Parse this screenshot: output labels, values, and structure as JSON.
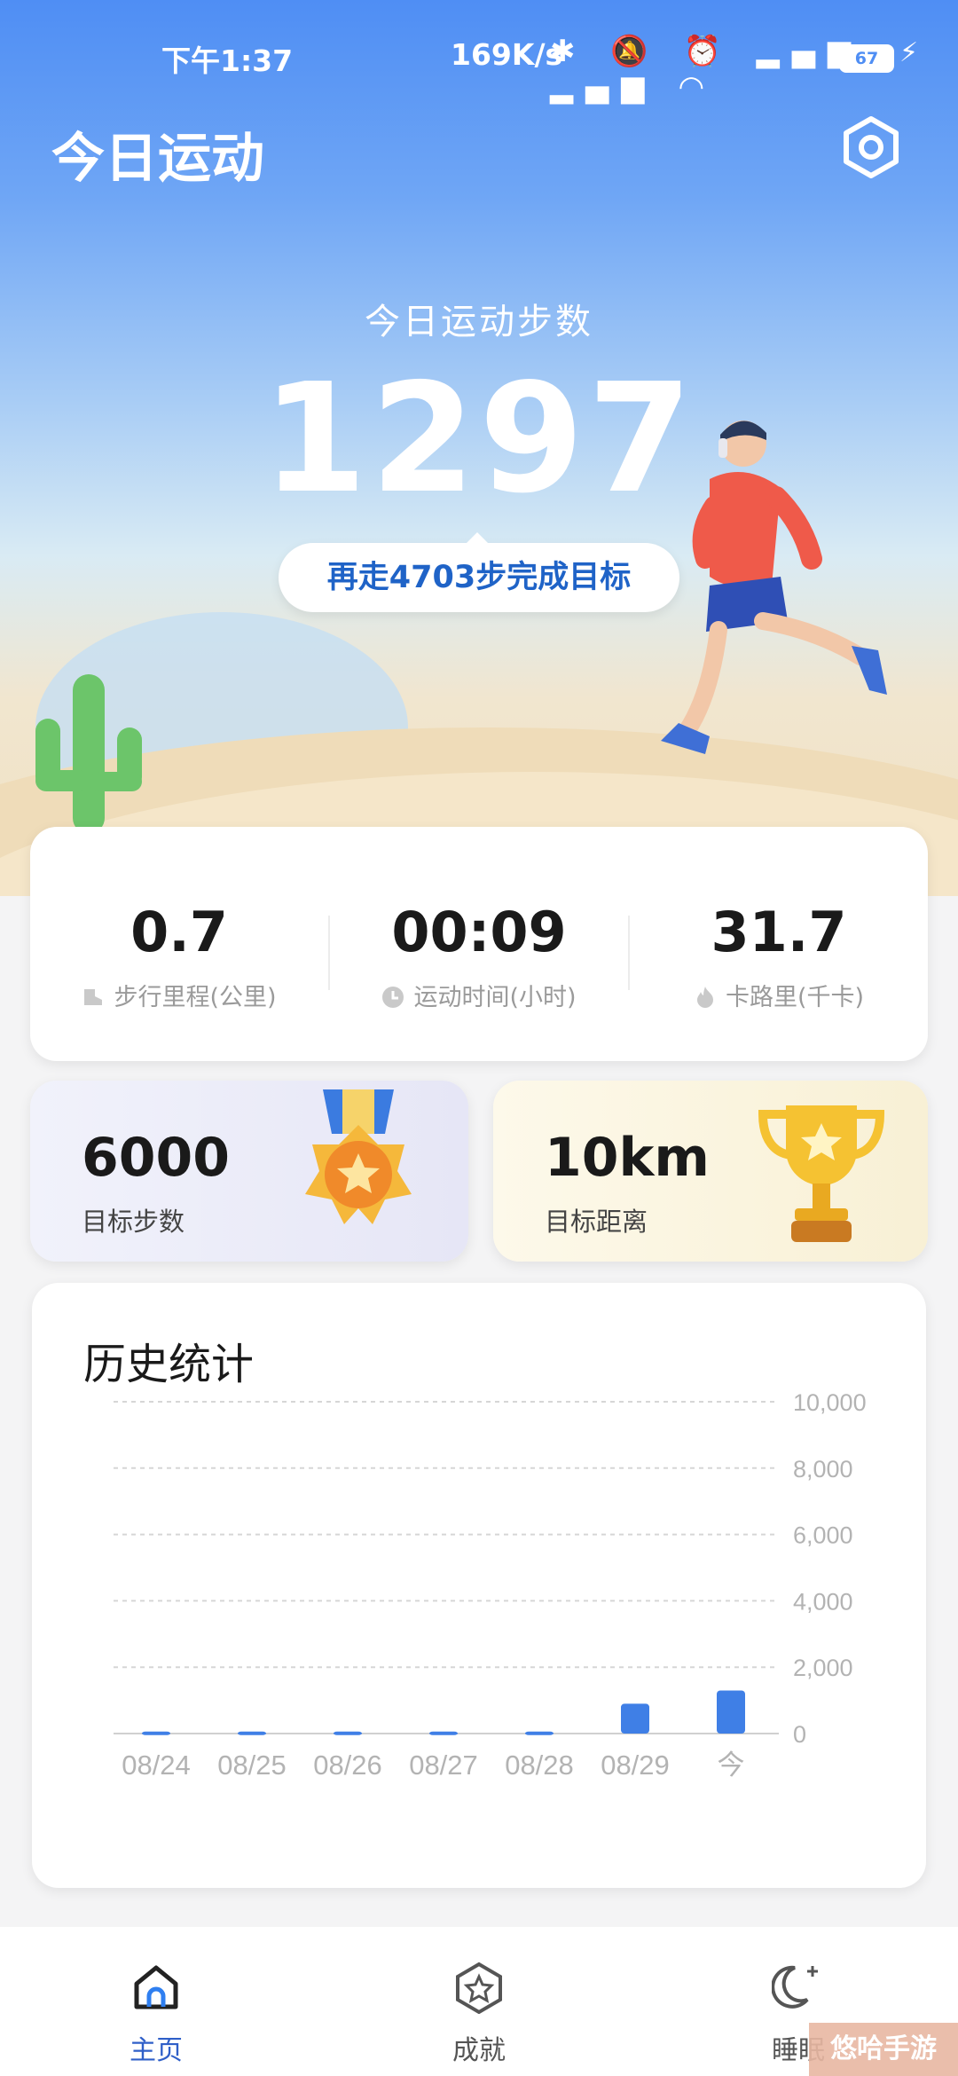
{
  "status_bar": {
    "time": "下午1:37",
    "network_speed": "169K/s",
    "battery": "67"
  },
  "header": {
    "title": "今日运动"
  },
  "today": {
    "label": "今日运动步数",
    "steps": "1297",
    "remaining_text": "再走4703步完成目标"
  },
  "stats": [
    {
      "value": "0.7",
      "label": "步行里程(公里)",
      "icon": "shoe-icon"
    },
    {
      "value": "00:09",
      "label": "运动时间(小时)",
      "icon": "clock-icon"
    },
    {
      "value": "31.7",
      "label": "卡路里(千卡)",
      "icon": "fire-icon"
    }
  ],
  "targets": {
    "steps": {
      "value": "6000",
      "label": "目标步数"
    },
    "distance": {
      "value": "10km",
      "label": "目标距离"
    }
  },
  "history": {
    "title": "历史统计"
  },
  "chart_data": {
    "type": "bar",
    "categories": [
      "08/24",
      "08/25",
      "08/26",
      "08/27",
      "08/28",
      "08/29",
      "今"
    ],
    "values": [
      60,
      60,
      60,
      60,
      60,
      900,
      1297
    ],
    "ylim": [
      0,
      10000
    ],
    "yticks": [
      "10,000",
      "8,000",
      "6,000",
      "4,000",
      "2,000",
      "0"
    ],
    "ytick_values": [
      10000,
      8000,
      6000,
      4000,
      2000,
      0
    ],
    "grid": true,
    "bar_color": "#3f7fe6"
  },
  "tabs": [
    {
      "label": "主页",
      "icon": "home-icon",
      "active": true
    },
    {
      "label": "成就",
      "icon": "achievement-icon",
      "active": false
    },
    {
      "label": "睡眠",
      "icon": "moon-icon",
      "active": false
    }
  ],
  "colors": {
    "primary": "#4f8ef4",
    "active_tab": "#2f5fc8",
    "inactive_tab": "#555555"
  },
  "watermark": "悠哈手游"
}
